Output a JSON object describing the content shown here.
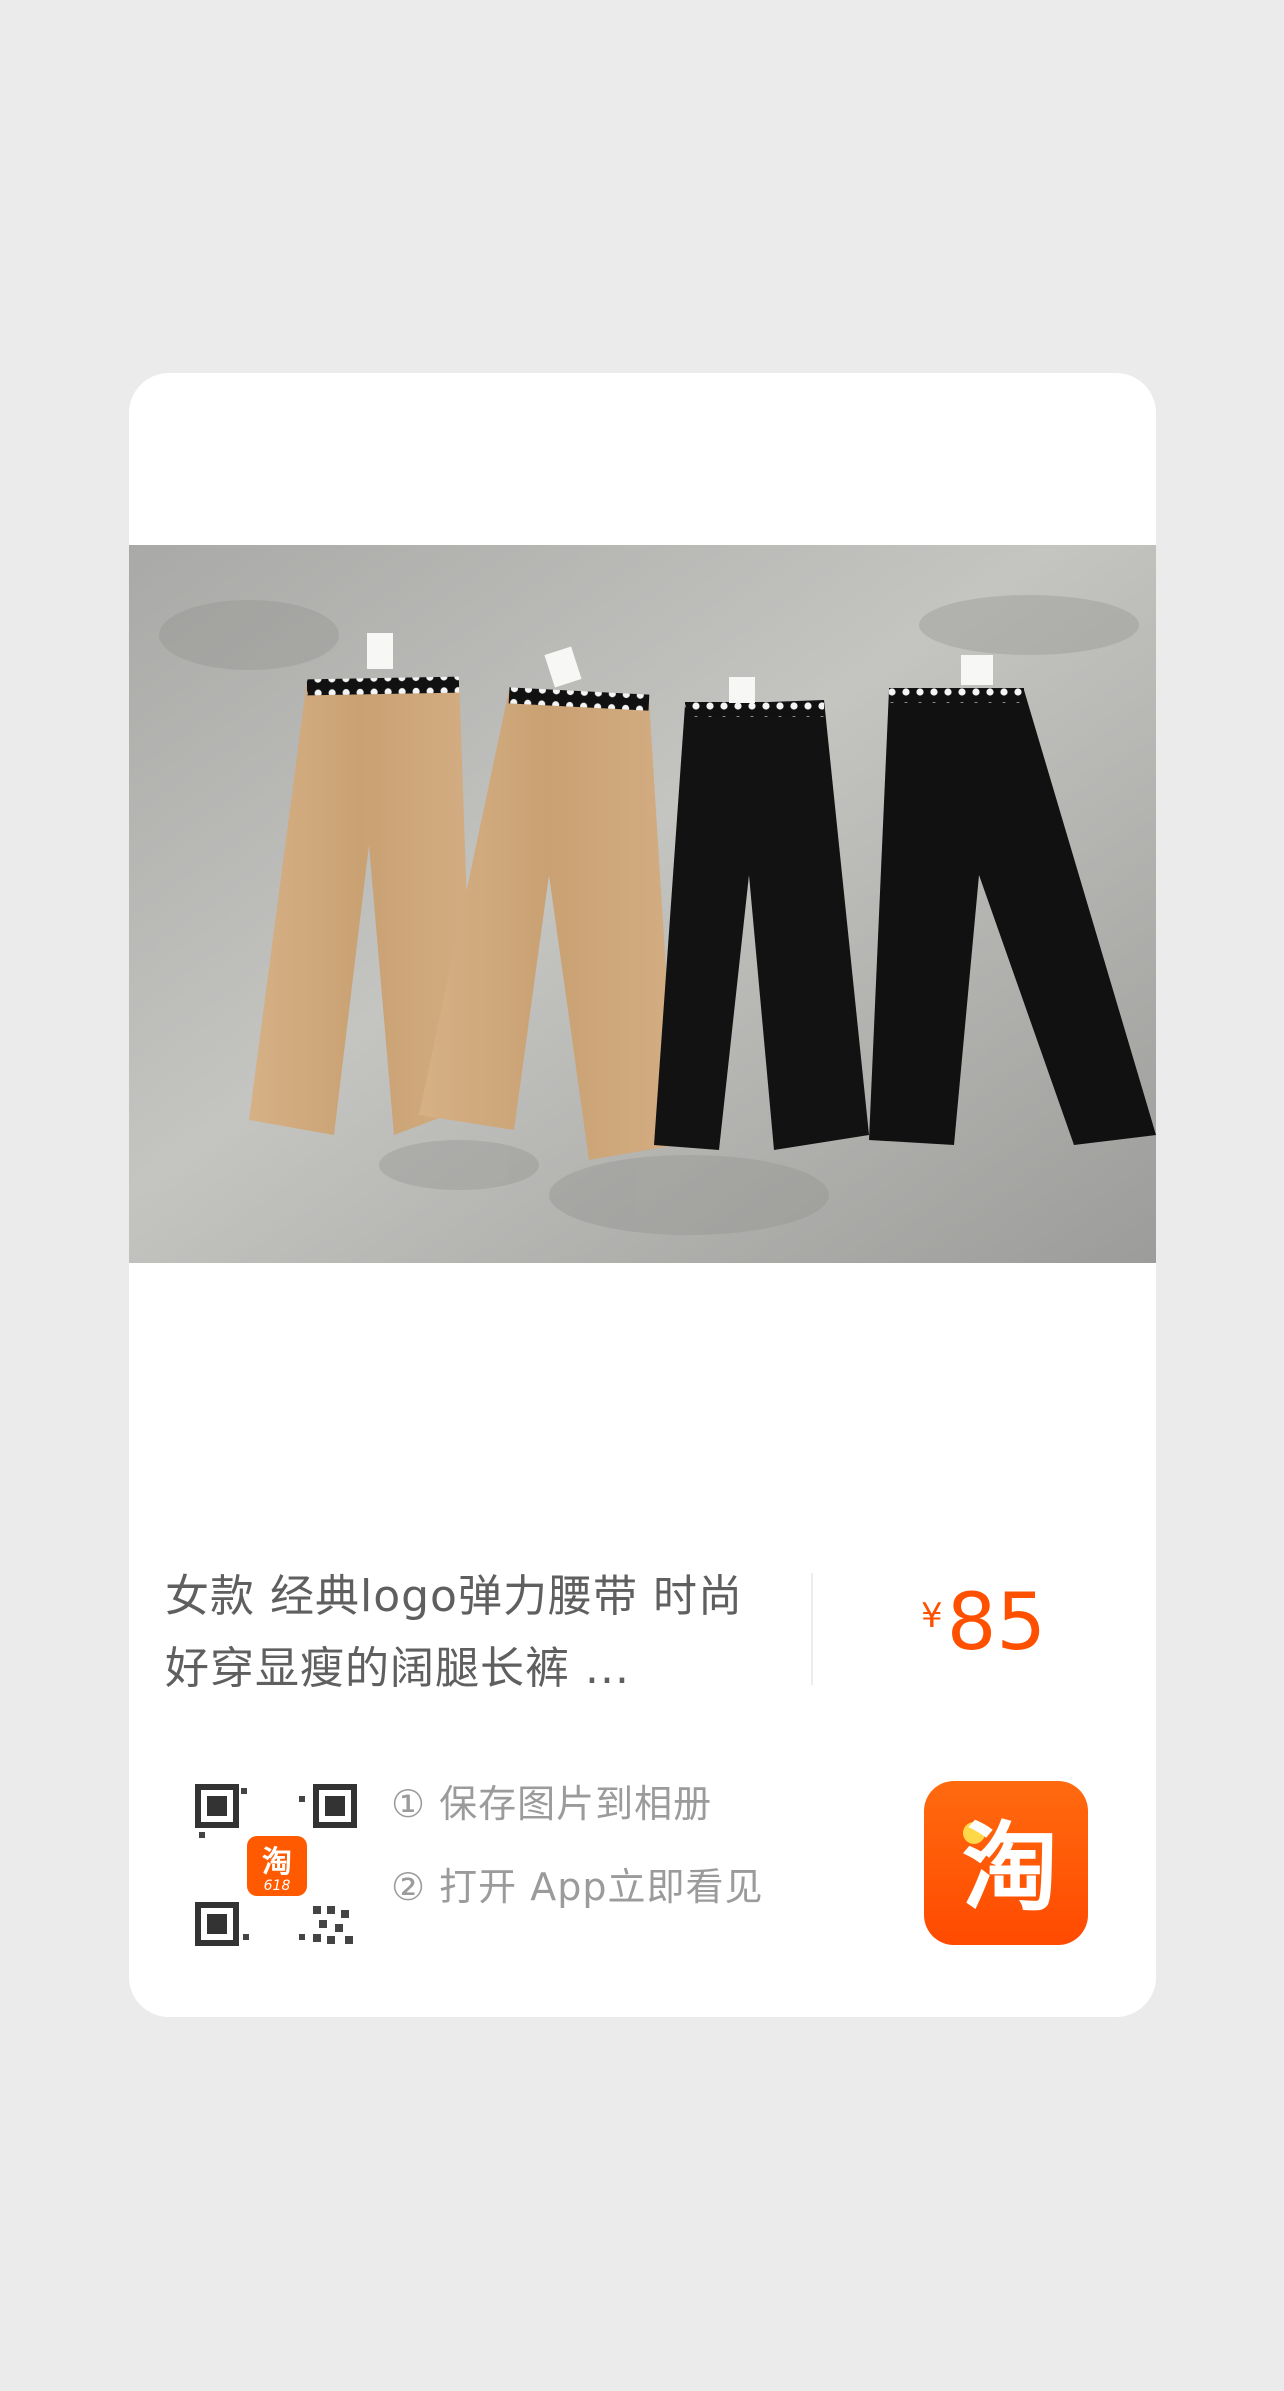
{
  "product": {
    "title": "女款 经典logo弹力腰带 时尚好穿显瘦的阔腿长裤 ...",
    "price_symbol": "¥",
    "price_value": "85",
    "image_alt": "product-photo-wide-leg-trousers"
  },
  "instructions": {
    "step1": "① 保存图片到相册",
    "step2": "② 打开 App立即看见"
  },
  "qr_badge": {
    "glyph": "淘",
    "sub": "618"
  },
  "app_icon": {
    "glyph": "淘"
  },
  "colors": {
    "page_bg": "#ebebeb",
    "card_bg": "#ffffff",
    "price": "#ff5000",
    "brand_orange": "#ff5a00",
    "text_title": "#5f5f5f",
    "text_hint": "#9b9b9b",
    "pants_khaki": "#cfa77b",
    "pants_black": "#111111"
  }
}
